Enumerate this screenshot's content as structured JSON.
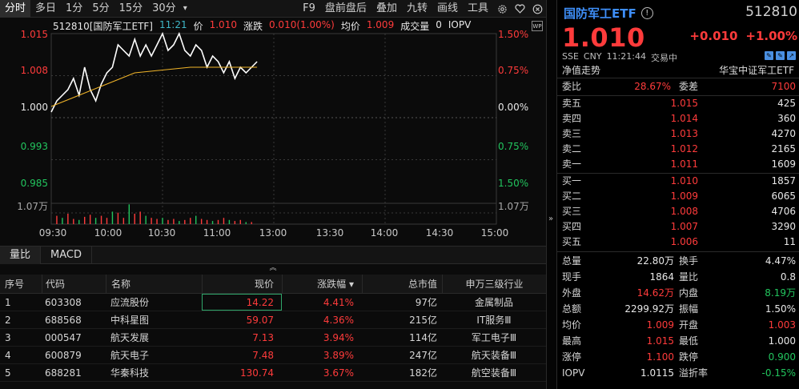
{
  "toolbar": {
    "periods": [
      "分时",
      "多日",
      "1分",
      "5分",
      "15分",
      "30分"
    ],
    "more": "▾",
    "right_items": [
      "F9",
      "盘前盘后",
      "叠加",
      "九转",
      "画线",
      "工具"
    ],
    "icons": [
      "gear-icon",
      "heart-icon",
      "close-circle-icon"
    ]
  },
  "chart": {
    "legend": {
      "code_name": "512810[国防军工ETF]",
      "time": "11:21",
      "price_label": "价",
      "price": "1.010",
      "chg_label": "涨跌",
      "chg": "0.010(1.00%)",
      "avg_label": "均价",
      "avg": "1.009",
      "vol_label": "成交量",
      "vol": "0",
      "iopv": "IOPV"
    },
    "wp_icon": "WP",
    "y_left": [
      "1.015",
      "1.008",
      "1.000",
      "0.993",
      "0.985",
      "1.07万"
    ],
    "y_right": [
      "1.50%",
      "0.75%",
      "0.00%",
      "0.75%",
      "1.50%",
      "1.07万"
    ],
    "x_labels": [
      "09:30",
      "10:00",
      "10:30",
      "11:00",
      "13:00",
      "13:30",
      "14:00",
      "14:30",
      "15:00"
    ]
  },
  "chart_data": {
    "type": "line",
    "prev_close": 1.0,
    "ylim": [
      0.985,
      1.015
    ],
    "series": [
      {
        "name": "价",
        "color": "#ffffff",
        "x": [
          "09:30",
          "09:33",
          "09:36",
          "09:39",
          "09:42",
          "09:45",
          "09:48",
          "09:51",
          "09:54",
          "09:57",
          "10:00",
          "10:03",
          "10:06",
          "10:09",
          "10:12",
          "10:15",
          "10:18",
          "10:21",
          "10:24",
          "10:27",
          "10:30",
          "10:33",
          "10:36",
          "10:39",
          "10:42",
          "10:45",
          "10:48",
          "10:51",
          "10:54",
          "10:57",
          "11:00",
          "11:03",
          "11:06",
          "11:09",
          "11:12",
          "11:15",
          "11:18",
          "11:21"
        ],
        "values": [
          1.001,
          1.003,
          1.004,
          1.005,
          1.007,
          1.004,
          1.009,
          1.005,
          1.003,
          1.006,
          1.008,
          1.009,
          1.013,
          1.012,
          1.011,
          1.014,
          1.011,
          1.013,
          1.011,
          1.013,
          1.015,
          1.012,
          1.013,
          1.015,
          1.012,
          1.011,
          1.013,
          1.012,
          1.009,
          1.011,
          1.01,
          1.008,
          1.01,
          1.007,
          1.009,
          1.008,
          1.009,
          1.01
        ]
      },
      {
        "name": "均价",
        "color": "#f0b429",
        "x": [
          "09:30",
          "09:45",
          "10:00",
          "10:15",
          "10:30",
          "10:45",
          "11:00",
          "11:21"
        ],
        "values": [
          1.002,
          1.004,
          1.006,
          1.008,
          1.0085,
          1.009,
          1.009,
          1.009
        ]
      }
    ],
    "volume_bars": [
      {
        "t": "09:33",
        "v": 0.4
      },
      {
        "t": "09:36",
        "v": 0.3
      },
      {
        "t": "09:39",
        "v": 0.5
      },
      {
        "t": "09:42",
        "v": 0.25
      },
      {
        "t": "09:45",
        "v": 0.2
      },
      {
        "t": "09:48",
        "v": 0.35
      },
      {
        "t": "09:51",
        "v": 0.45
      },
      {
        "t": "09:54",
        "v": 0.3
      },
      {
        "t": "09:57",
        "v": 0.4
      },
      {
        "t": "10:00",
        "v": 0.3
      },
      {
        "t": "10:03",
        "v": 0.6
      },
      {
        "t": "10:06",
        "v": 0.55
      },
      {
        "t": "10:09",
        "v": 0.3
      },
      {
        "t": "10:12",
        "v": 0.95
      },
      {
        "t": "10:15",
        "v": 0.5
      },
      {
        "t": "10:18",
        "v": 0.6
      },
      {
        "t": "10:21",
        "v": 0.4
      },
      {
        "t": "10:24",
        "v": 0.3
      },
      {
        "t": "10:27",
        "v": 0.25
      },
      {
        "t": "10:30",
        "v": 0.3
      },
      {
        "t": "10:33",
        "v": 0.2
      },
      {
        "t": "10:36",
        "v": 0.25
      },
      {
        "t": "10:39",
        "v": 0.15
      },
      {
        "t": "10:42",
        "v": 0.2
      },
      {
        "t": "10:45",
        "v": 0.3
      },
      {
        "t": "10:48",
        "v": 0.4
      },
      {
        "t": "10:51",
        "v": 0.25
      },
      {
        "t": "10:54",
        "v": 0.2
      },
      {
        "t": "10:57",
        "v": 0.15
      },
      {
        "t": "11:00",
        "v": 0.2
      },
      {
        "t": "11:03",
        "v": 0.3
      },
      {
        "t": "11:06",
        "v": 0.2
      },
      {
        "t": "11:09",
        "v": 0.15
      },
      {
        "t": "11:12",
        "v": 0.2
      },
      {
        "t": "11:15",
        "v": 0.1
      },
      {
        "t": "11:18",
        "v": 0.1
      }
    ]
  },
  "subtabs": [
    "量比",
    "MACD"
  ],
  "collapse_icon": "︽",
  "table": {
    "headers": [
      "序号",
      "代码",
      "名称",
      "现价",
      "涨跌幅 ▾",
      "总市值",
      "申万三级行业"
    ],
    "rows": [
      [
        "1",
        "603308",
        "应流股份",
        "14.22",
        "4.41%",
        "97亿",
        "金属制品"
      ],
      [
        "2",
        "688568",
        "中科星图",
        "59.07",
        "4.36%",
        "215亿",
        "IT服务Ⅲ"
      ],
      [
        "3",
        "000547",
        "航天发展",
        "7.13",
        "3.94%",
        "114亿",
        "军工电子Ⅲ"
      ],
      [
        "4",
        "600879",
        "航天电子",
        "7.48",
        "3.89%",
        "247亿",
        "航天装备Ⅲ"
      ],
      [
        "5",
        "688281",
        "华秦科技",
        "130.74",
        "3.67%",
        "182亿",
        "航空装备Ⅲ"
      ]
    ]
  },
  "divider_arrow": "»",
  "quote": {
    "name": "国防军工ETF",
    "info": "!",
    "code": "512810",
    "price": "1.010",
    "change": "+0.010",
    "change_pct": "+1.00%",
    "meta": [
      "SSE",
      "CNY",
      "11:21:44",
      "交易中"
    ],
    "nav_left": "净值走势",
    "nav_right": "华宝中证军工ETF",
    "webi": {
      "label": "委比",
      "value": "28.67%",
      "label2": "委差",
      "value2": "7100"
    },
    "asks": [
      {
        "label": "卖五",
        "price": "1.015",
        "vol": "425"
      },
      {
        "label": "卖四",
        "price": "1.014",
        "vol": "360"
      },
      {
        "label": "卖三",
        "price": "1.013",
        "vol": "4270"
      },
      {
        "label": "卖二",
        "price": "1.012",
        "vol": "2165"
      },
      {
        "label": "卖一",
        "price": "1.011",
        "vol": "1609"
      }
    ],
    "bids": [
      {
        "label": "买一",
        "price": "1.010",
        "vol": "1857"
      },
      {
        "label": "买二",
        "price": "1.009",
        "vol": "6065"
      },
      {
        "label": "买三",
        "price": "1.008",
        "vol": "4706"
      },
      {
        "label": "买四",
        "price": "1.007",
        "vol": "3290"
      },
      {
        "label": "买五",
        "price": "1.006",
        "vol": "11"
      }
    ],
    "stats": [
      {
        "l1": "总量",
        "v1": "22.80万",
        "l2": "换手",
        "v2": "4.47%"
      },
      {
        "l1": "现手",
        "v1": "1864",
        "l2": "量比",
        "v2": "0.8"
      },
      {
        "l1": "外盘",
        "v1": "14.62万",
        "l2": "内盘",
        "v2": "8.19万"
      },
      {
        "l1": "总额",
        "v1": "2299.92万",
        "l2": "振幅",
        "v2": "1.50%"
      },
      {
        "l1": "均价",
        "v1": "1.009",
        "l2": "开盘",
        "v2": "1.003"
      },
      {
        "l1": "最高",
        "v1": "1.015",
        "l2": "最低",
        "v2": "1.000"
      },
      {
        "l1": "涨停",
        "v1": "1.100",
        "l2": "跌停",
        "v2": "0.900"
      },
      {
        "l1": "IOPV",
        "v1": "1.0115",
        "l2": "溢折率",
        "v2": "-0.15%"
      }
    ]
  }
}
